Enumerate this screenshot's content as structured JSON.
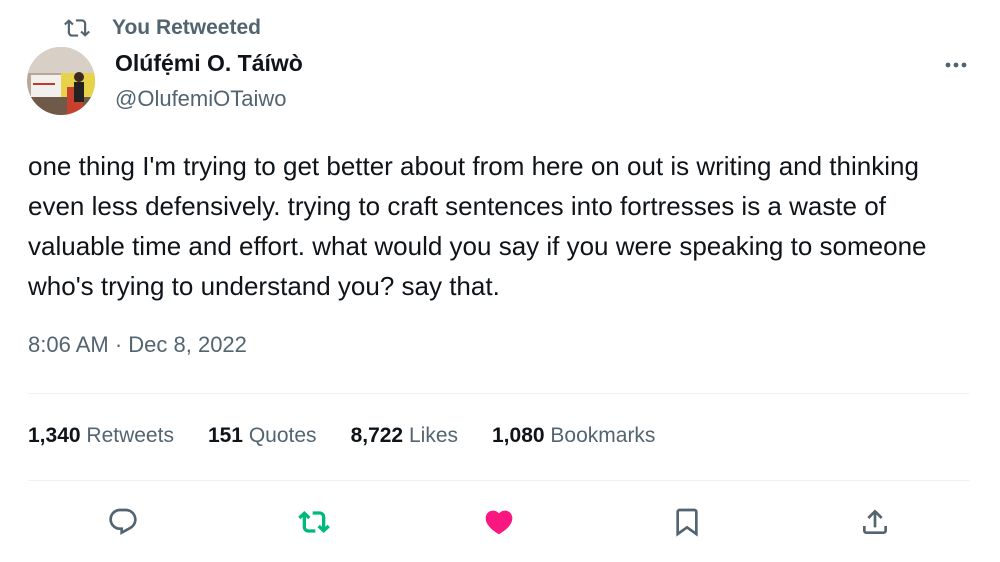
{
  "retweet_banner": {
    "icon": "retweet-icon",
    "label": "You Retweeted"
  },
  "author": {
    "name": "Olúfẹ́mi O. Táíwò",
    "handle": "@OlufemiOTaiwo"
  },
  "tweet": {
    "text": "one thing I'm trying to get better about from here on out is writing and thinking even less defensively. trying to craft sentences into fortresses is a waste of valuable time and effort. what would you say if you were speaking to someone who's trying to understand you? say that.",
    "timestamp": "8:06 AM · Dec 8, 2022"
  },
  "stats": {
    "retweets": {
      "count": "1,340",
      "label": "Retweets"
    },
    "quotes": {
      "count": "151",
      "label": "Quotes"
    },
    "likes": {
      "count": "8,722",
      "label": "Likes"
    },
    "bookmarks": {
      "count": "1,080",
      "label": "Bookmarks"
    }
  },
  "actions": {
    "reply_icon": "reply-icon",
    "retweet_icon": "retweet-icon",
    "like_icon": "heart-icon",
    "bookmark_icon": "bookmark-icon",
    "share_icon": "share-icon"
  },
  "colors": {
    "text_primary": "#0f1419",
    "text_secondary": "#536471",
    "retweet_active": "#00ba7c",
    "like_active": "#f91880",
    "divider": "#eff3f4"
  }
}
